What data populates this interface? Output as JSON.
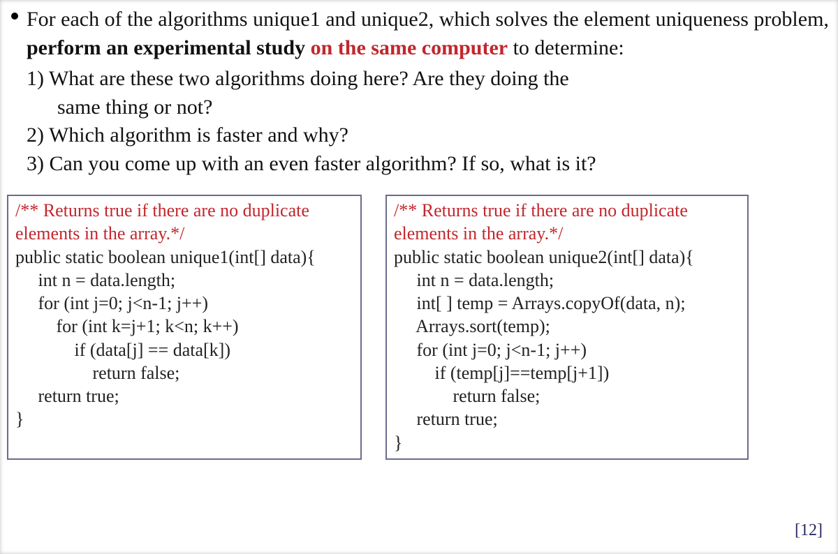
{
  "bullet": {
    "part1": "For each of the algorithms unique1 and unique2, which solves the element uniqueness problem, ",
    "bold1": "perform an experimental study",
    "red1": " on the same computer",
    "part2": " to determine:"
  },
  "questions": {
    "q1a": "1) What are these two algorithms doing here? Are they doing the",
    "q1b": "same thing or not?",
    "q2": "2) Which algorithm is faster and why?",
    "q3": "3) Can you come up with an even faster algorithm? If so, what is it?"
  },
  "code1": {
    "c1": "/** Returns true if there are no duplicate",
    "c2": "elements in the array.*/",
    "l1": "public static boolean unique1(int[] data){",
    "l2": "     int n = data.length;",
    "l3": "     for (int j=0; j<n-1; j++)",
    "l4": "         for (int k=j+1; k<n; k++)",
    "l5": "             if (data[j] == data[k])",
    "l6": "                 return false;",
    "l7": "     return true;",
    "l8": "}"
  },
  "code2": {
    "c1": "/** Returns true if there are no duplicate",
    "c2": "elements in the array.*/",
    "l1": "public static boolean unique2(int[] data){",
    "l2": "     int n = data.length;",
    "l3": "     int[ ] temp = Arrays.copyOf(data, n);",
    "l4": "     Arrays.sort(temp);",
    "l5": "     for (int j=0; j<n-1; j++)",
    "l6": "         if (temp[j]==temp[j+1])",
    "l7": "             return false;",
    "l8": "     return true;",
    "l9": "}"
  },
  "page_num": "[12]"
}
